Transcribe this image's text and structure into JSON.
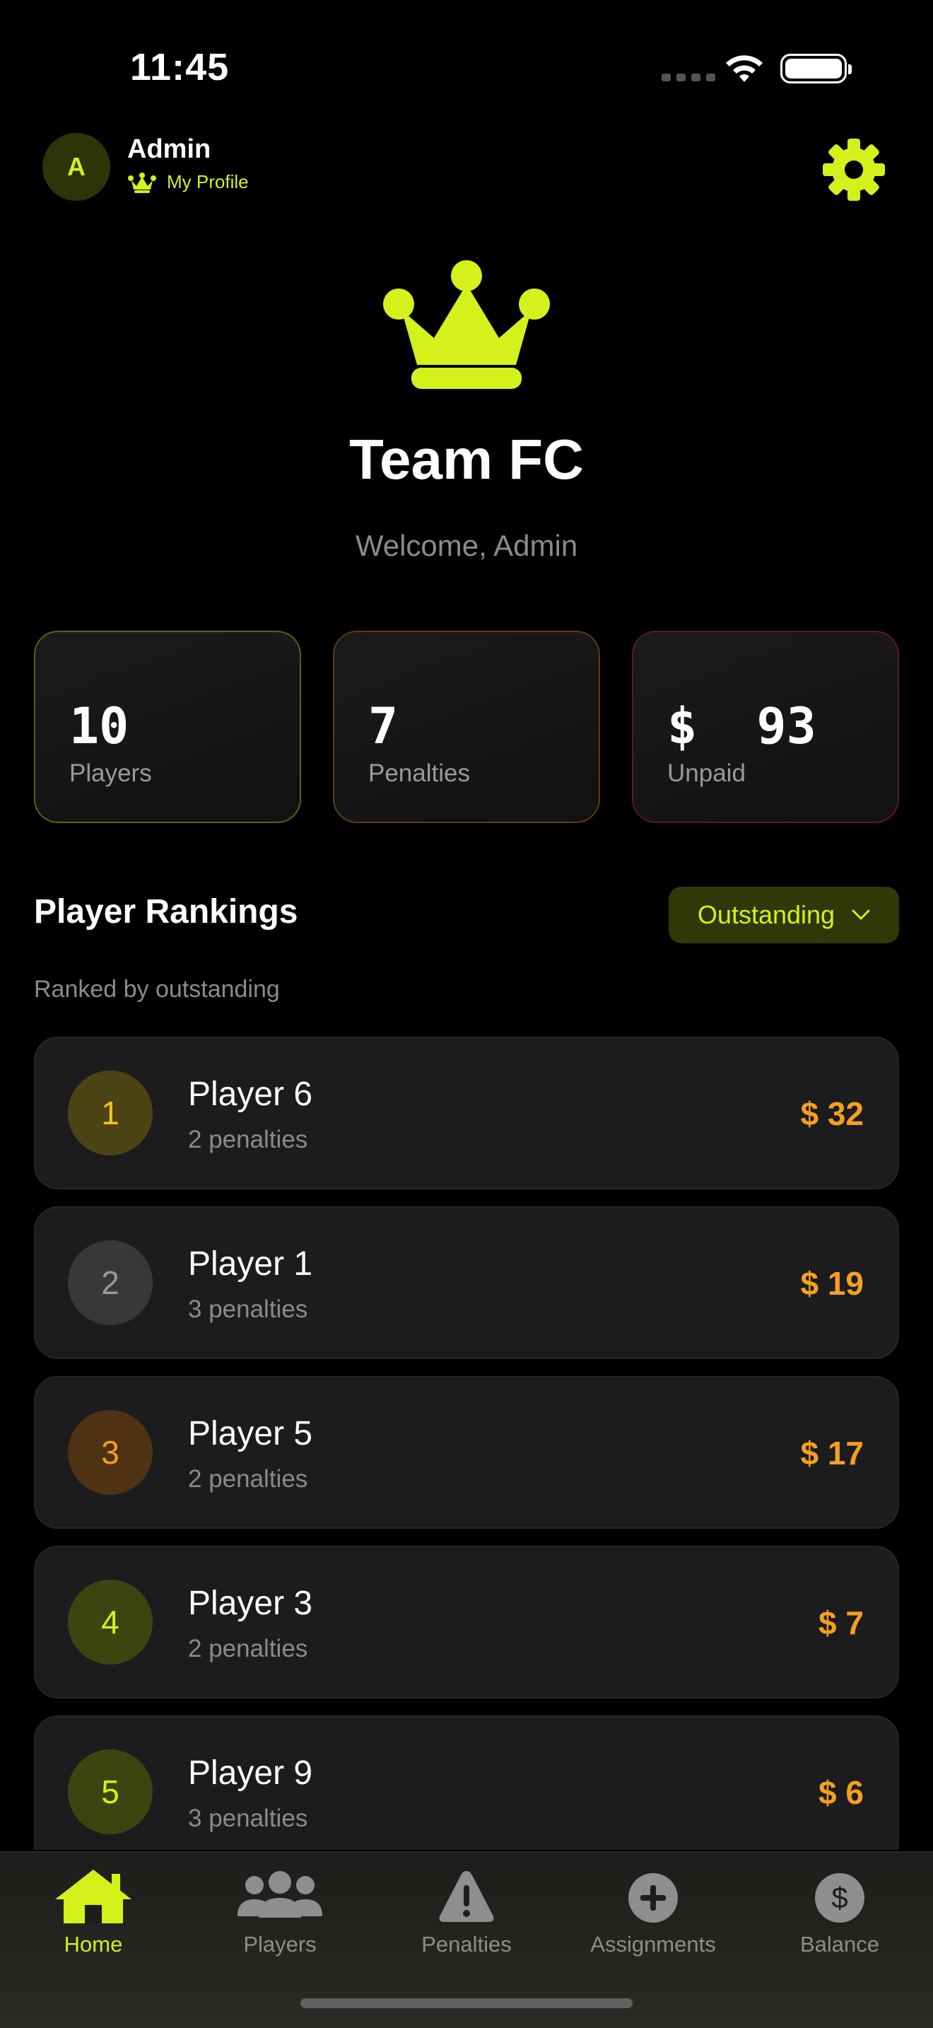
{
  "status_bar": {
    "time": "11:45"
  },
  "header": {
    "avatar_initial": "A",
    "user_name": "Admin",
    "profile_link": "My Profile"
  },
  "hero": {
    "team_name": "Team FC",
    "welcome": "Welcome, Admin"
  },
  "stats": [
    {
      "value": "10",
      "label": "Players",
      "accent": "#59650f"
    },
    {
      "value": "7",
      "label": "Penalties",
      "accent": "#5c3c10"
    },
    {
      "value": "$  93",
      "label": "Unpaid",
      "accent": "#5e1a1a"
    }
  ],
  "rankings": {
    "title": "Player Rankings",
    "filter": "Outstanding",
    "subtitle": "Ranked by outstanding",
    "players": [
      {
        "rank": "1",
        "name": "Player 6",
        "penalties": "2 penalties",
        "amount": "$ 32",
        "badge_bg": "#4d4416",
        "badge_fg": "#f5c518"
      },
      {
        "rank": "2",
        "name": "Player 1",
        "penalties": "3 penalties",
        "amount": "$ 19",
        "badge_bg": "#38383a",
        "badge_fg": "#9a9a9a"
      },
      {
        "rank": "3",
        "name": "Player 5",
        "penalties": "2 penalties",
        "amount": "$ 17",
        "badge_bg": "#4f3214",
        "badge_fg": "#f4a020"
      },
      {
        "rank": "4",
        "name": "Player 3",
        "penalties": "2 penalties",
        "amount": "$ 7",
        "badge_bg": "#3c4510",
        "badge_fg": "#d4f11b"
      },
      {
        "rank": "5",
        "name": "Player 9",
        "penalties": "3 penalties",
        "amount": "$ 6",
        "badge_bg": "#3c4510",
        "badge_fg": "#d4f11b"
      }
    ]
  },
  "tabs": [
    {
      "label": "Home",
      "icon": "home-icon",
      "active": true
    },
    {
      "label": "Players",
      "icon": "players-icon",
      "active": false
    },
    {
      "label": "Penalties",
      "icon": "warning-icon",
      "active": false
    },
    {
      "label": "Assignments",
      "icon": "plus-circle-icon",
      "active": false
    },
    {
      "label": "Balance",
      "icon": "dollar-circle-icon",
      "active": false
    }
  ],
  "colors": {
    "accent": "#d4f11b",
    "amount": "#f4a020",
    "card_bg": "#1c1c1e"
  }
}
